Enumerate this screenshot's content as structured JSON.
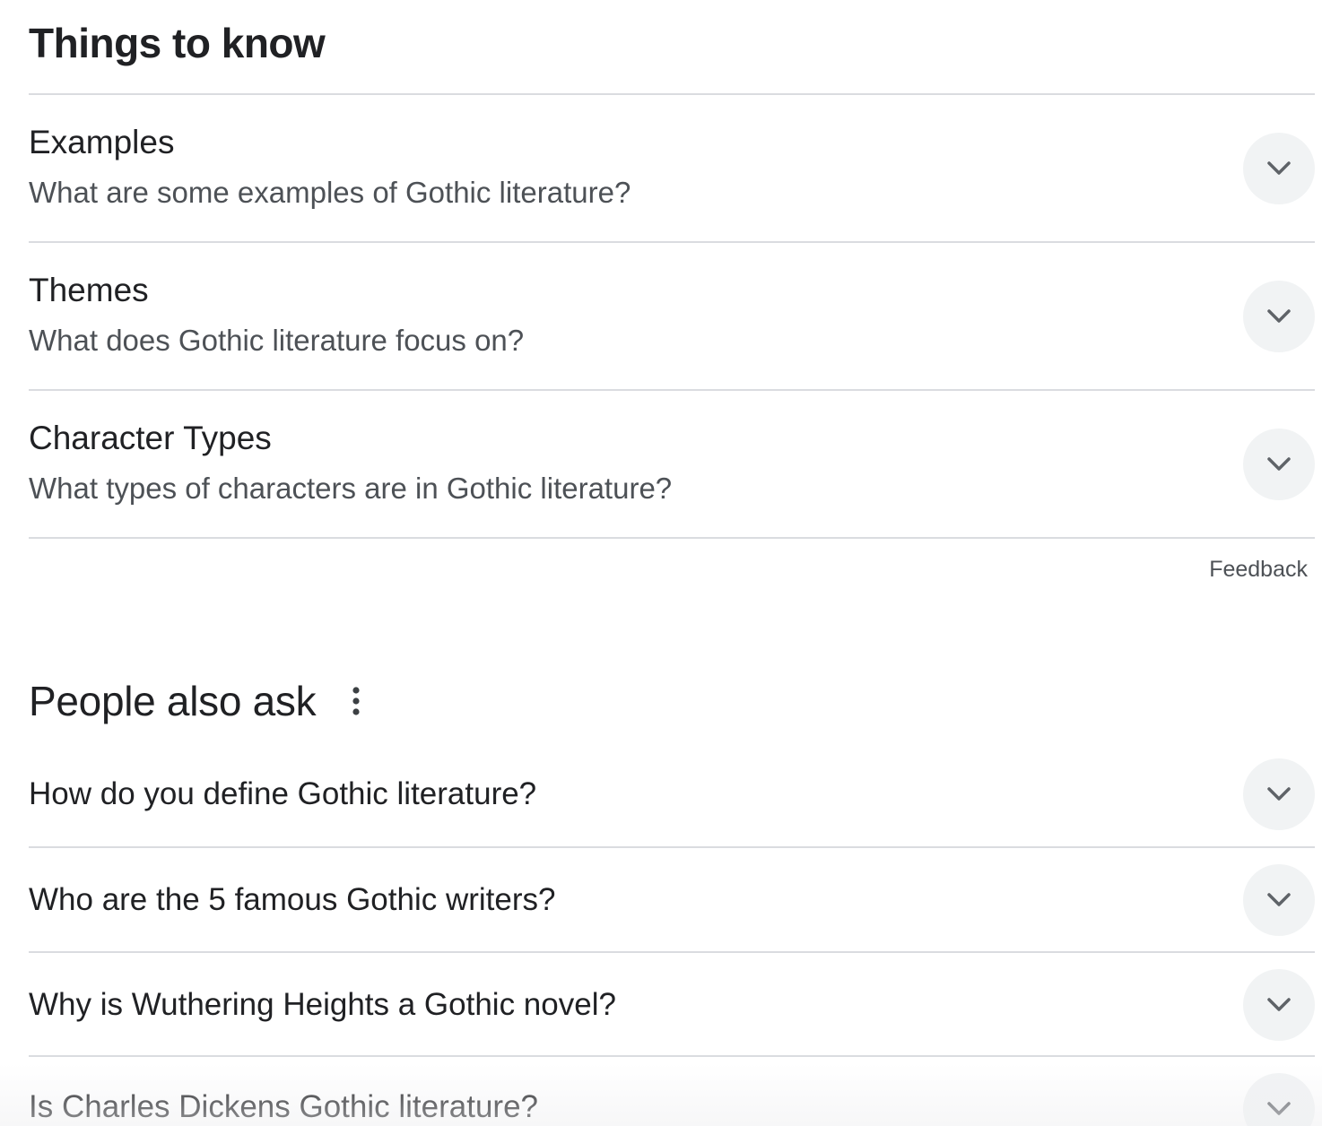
{
  "things_to_know": {
    "title": "Things to know",
    "items": [
      {
        "heading": "Examples",
        "question": "What are some examples of Gothic literature?"
      },
      {
        "heading": "Themes",
        "question": "What does Gothic literature focus on?"
      },
      {
        "heading": "Character Types",
        "question": "What types of characters are in Gothic literature?"
      }
    ],
    "feedback_label": "Feedback"
  },
  "people_also_ask": {
    "title": "People also ask",
    "questions": [
      "How do you define Gothic literature?",
      "Who are the 5 famous Gothic writers?",
      "Why is Wuthering Heights a Gothic novel?",
      "Is Charles Dickens Gothic literature?"
    ]
  },
  "icons": {
    "expand": "chevron-down-icon",
    "more": "more-vert-icon"
  },
  "colors": {
    "text_primary": "#202124",
    "text_secondary": "#4d5156",
    "divider": "#dadce0",
    "button_bg": "#f1f3f4",
    "icon": "#5f6368"
  }
}
